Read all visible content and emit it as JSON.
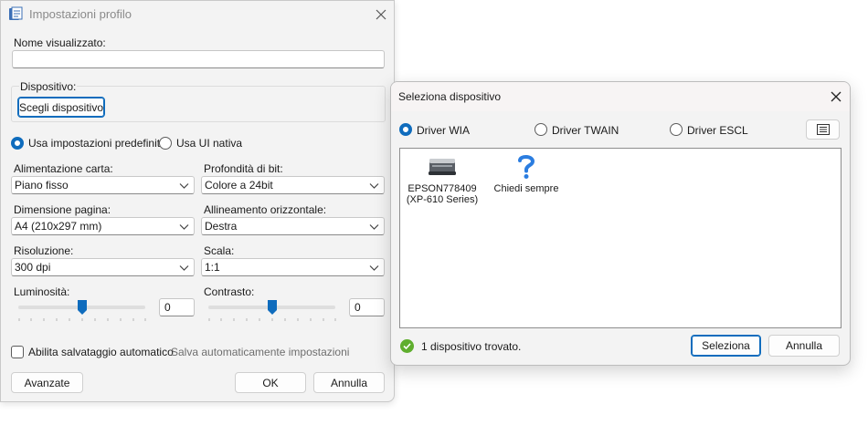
{
  "profile_window": {
    "title": "Impostazioni profilo",
    "display_name_label": "Nome visualizzato:",
    "display_name_value": "",
    "device_group_label": "Dispositivo:",
    "choose_device_button": "Scegli dispositivo",
    "use_default_settings": "Usa impostazioni predefinite",
    "use_native_ui": "Usa UI nativa",
    "paper_source_label": "Alimentazione carta:",
    "paper_source_value": "Piano fisso",
    "bit_depth_label": "Profondità di bit:",
    "bit_depth_value": "Colore a 24bit",
    "page_size_label": "Dimensione pagina:",
    "page_size_value": "A4 (210x297 mm)",
    "horizontal_align_label": "Allineamento orizzontale:",
    "horizontal_align_value": "Destra",
    "resolution_label": "Risoluzione:",
    "resolution_value": "300 dpi",
    "scale_label": "Scala:",
    "scale_value": "1:1",
    "brightness_label": "Luminosità:",
    "brightness_value": "0",
    "contrast_label": "Contrasto:",
    "contrast_value": "0",
    "autosave_label": "Abilita salvataggio automatico",
    "autosave_hint": "Salva automaticamente impostazioni",
    "advanced_button": "Avanzate",
    "ok_button": "OK",
    "cancel_button": "Annulla"
  },
  "device_window": {
    "title": "Seleziona dispositivo",
    "driver_wia": "Driver WIA",
    "driver_twain": "Driver TWAIN",
    "driver_escl": "Driver ESCL",
    "devices": [
      {
        "line1": "EPSON778409",
        "line2": "(XP-610 Series)"
      },
      {
        "line1": "Chiedi sempre",
        "line2": ""
      }
    ],
    "status_text": "1 dispositivo trovato.",
    "select_button": "Seleziona",
    "cancel_button": "Annulla"
  },
  "colors": {
    "accent": "#0f6cbd",
    "success": "#5fae2e"
  }
}
